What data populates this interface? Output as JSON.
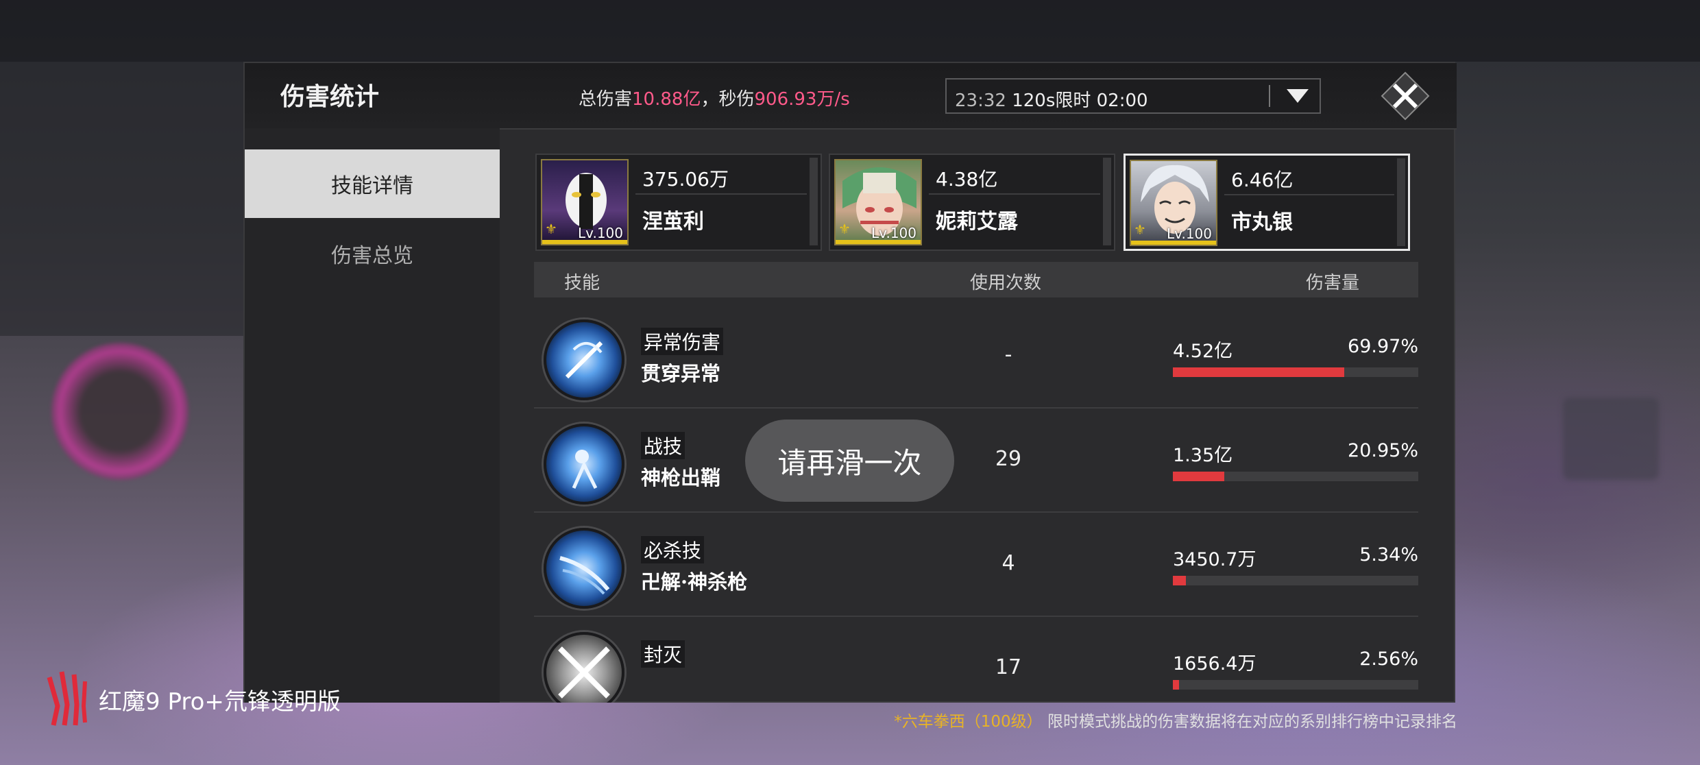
{
  "panel": {
    "title": "伤害统计",
    "totals": {
      "total_label": "总伤害",
      "total_value": "10.88亿",
      "sep": "，",
      "dps_label": "秒伤",
      "dps_value": "906.93万/s"
    },
    "time_select": {
      "time": "23:32",
      "mode": "120s限时 02:00"
    }
  },
  "nav": [
    {
      "label": "技能详情",
      "active": true
    },
    {
      "label": "伤害总览",
      "active": false
    }
  ],
  "characters": [
    {
      "damage": "375.06万",
      "name": "涅茧利",
      "level": "Lv.100",
      "selected": false
    },
    {
      "damage": "4.38亿",
      "name": "妮莉艾露",
      "level": "Lv.100",
      "selected": false
    },
    {
      "damage": "6.46亿",
      "name": "市丸银",
      "level": "Lv.100",
      "selected": true
    }
  ],
  "table": {
    "headers": {
      "skill": "技能",
      "uses": "使用次数",
      "damage": "伤害量"
    },
    "rows": [
      {
        "type": "异常伤害",
        "name": "贯穿异常",
        "uses": "-",
        "damage": "4.52亿",
        "percent": "69.97%",
        "fraction": 0.6997
      },
      {
        "type": "战技",
        "name": "神枪出鞘",
        "uses": "29",
        "damage": "1.35亿",
        "percent": "20.95%",
        "fraction": 0.2095
      },
      {
        "type": "必杀技",
        "name": "卍解·神杀枪",
        "uses": "4",
        "damage": "3450.7万",
        "percent": "5.34%",
        "fraction": 0.0534
      },
      {
        "type": "封灭",
        "name": "",
        "uses": "17",
        "damage": "1656.4万",
        "percent": "2.56%",
        "fraction": 0.0256
      }
    ]
  },
  "toast": "请再滑一次",
  "footer": {
    "asterisk": "*",
    "highlight": "六车拳西（100级）",
    "text": "限时模式挑战的伤害数据将在对应的系别排行榜中记录排名"
  },
  "brand": {
    "text": "红魔9 Pro+氘锋透明版"
  },
  "colors": {
    "accent_pink": "#ff5a8a",
    "bar_red": "#e13a3e",
    "gold": "#e8b326"
  }
}
